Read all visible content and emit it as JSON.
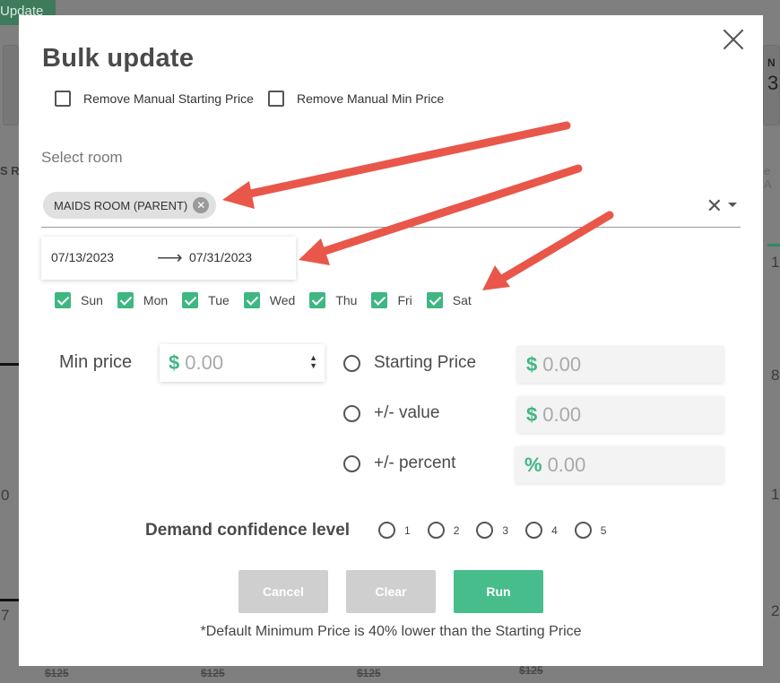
{
  "background": {
    "update_button_label": "Update",
    "col_header_left": "S R",
    "col_header_right": "e A",
    "stat_label": "N",
    "stat_value": "3",
    "row_values": [
      "0",
      "7",
      "1",
      "8",
      "1",
      "2"
    ],
    "strike_prices": [
      "$125",
      "$125",
      "$125",
      "$125"
    ]
  },
  "modal": {
    "title": "Bulk update",
    "remove_manual_starting_label": "Remove Manual Starting Price",
    "remove_manual_min_label": "Remove Manual Min Price",
    "select_room_label": "Select room",
    "selected_room": "MAIDS ROOM (PARENT)",
    "date_from": "07/13/2023",
    "date_to": "07/31/2023",
    "days": [
      "Sun",
      "Mon",
      "Tue",
      "Wed",
      "Thu",
      "Fri",
      "Sat"
    ],
    "min_price_label": "Min price",
    "min_price_value": "0.00",
    "options": [
      {
        "label": "Starting Price",
        "symbol": "$",
        "value": "0.00"
      },
      {
        "label": "+/- value",
        "symbol": "$",
        "value": "0.00"
      },
      {
        "label": "+/- percent",
        "symbol": "%",
        "value": "0.00"
      }
    ],
    "demand_label": "Demand confidence level",
    "levels": [
      "1",
      "2",
      "3",
      "4",
      "5"
    ],
    "cancel_label": "Cancel",
    "clear_label": "Clear",
    "run_label": "Run",
    "footnote": "*Default Minimum Price is 40% lower than the Starting Price"
  },
  "colors": {
    "accent_green": "#3fb783",
    "run_button": "#47bd8c",
    "disabled_button": "#cfcfcf",
    "annotation_arrow": "#e8574a"
  }
}
